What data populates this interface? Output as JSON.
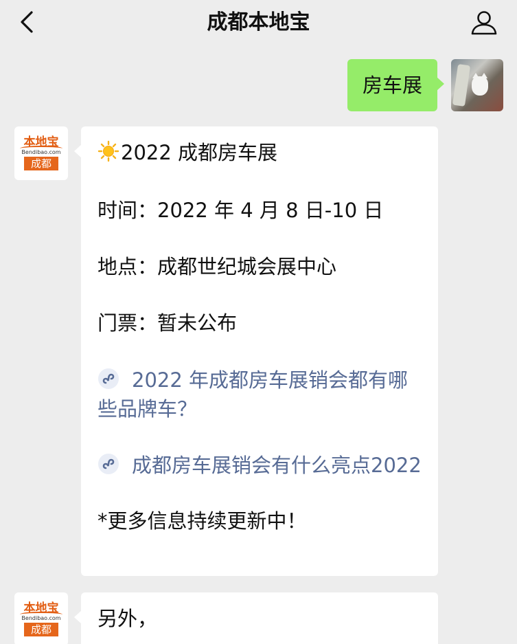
{
  "header": {
    "title": "成都本地宝",
    "back_icon": "chevron-left-icon",
    "profile_icon": "person-icon"
  },
  "outgoing": {
    "text": "房车展"
  },
  "account": {
    "logo_top": "本地宝",
    "logo_domain": "Bendibao.com",
    "logo_city": "成都"
  },
  "message1": {
    "title": "2022 成都房车展",
    "time": "时间：2022 年 4 月 8 日-10 日",
    "place": "地点：成都世纪城会展中心",
    "ticket": "门票：暂未公布",
    "link1": "2022 年成都房车展销会都有哪些品牌车？",
    "link2": "成都房车展销会有什么亮点2022",
    "note": "*更多信息持续更新中！"
  },
  "message2": {
    "text": "另外，"
  },
  "colors": {
    "background": "#ededed",
    "outgoing_bubble": "#95ec69",
    "link": "#576b95",
    "brand_orange": "#e5661b"
  }
}
